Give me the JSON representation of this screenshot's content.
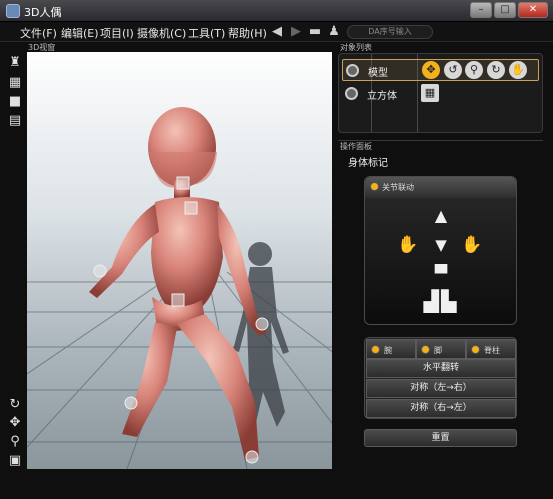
{
  "window": {
    "title": "3D人偶",
    "min": "–",
    "max": "□",
    "close": "✕"
  },
  "menu": {
    "items": [
      "文件(F)",
      "编辑(E)",
      "项目(I)",
      "摄像机(C)",
      "工具(T)",
      "帮助(H)"
    ]
  },
  "search": {
    "placeholder": "DA序号输入"
  },
  "viewport": {
    "label": "3D视窗"
  },
  "objects": {
    "title": "对象列表",
    "rows": [
      "模型",
      "立方体"
    ]
  },
  "ops": {
    "title": "操作面板",
    "body_label": "身体标记",
    "joint_link": "关节联动",
    "axes": [
      "腕",
      "脚",
      "脊柱"
    ],
    "buttons": {
      "flip": "水平翻转",
      "sym_lr": "对称（左→右）",
      "sym_rl": "对称（右→左）",
      "reset": "重置"
    }
  },
  "colors": {
    "accent": "#f2b21c",
    "model": "#d9847a"
  }
}
